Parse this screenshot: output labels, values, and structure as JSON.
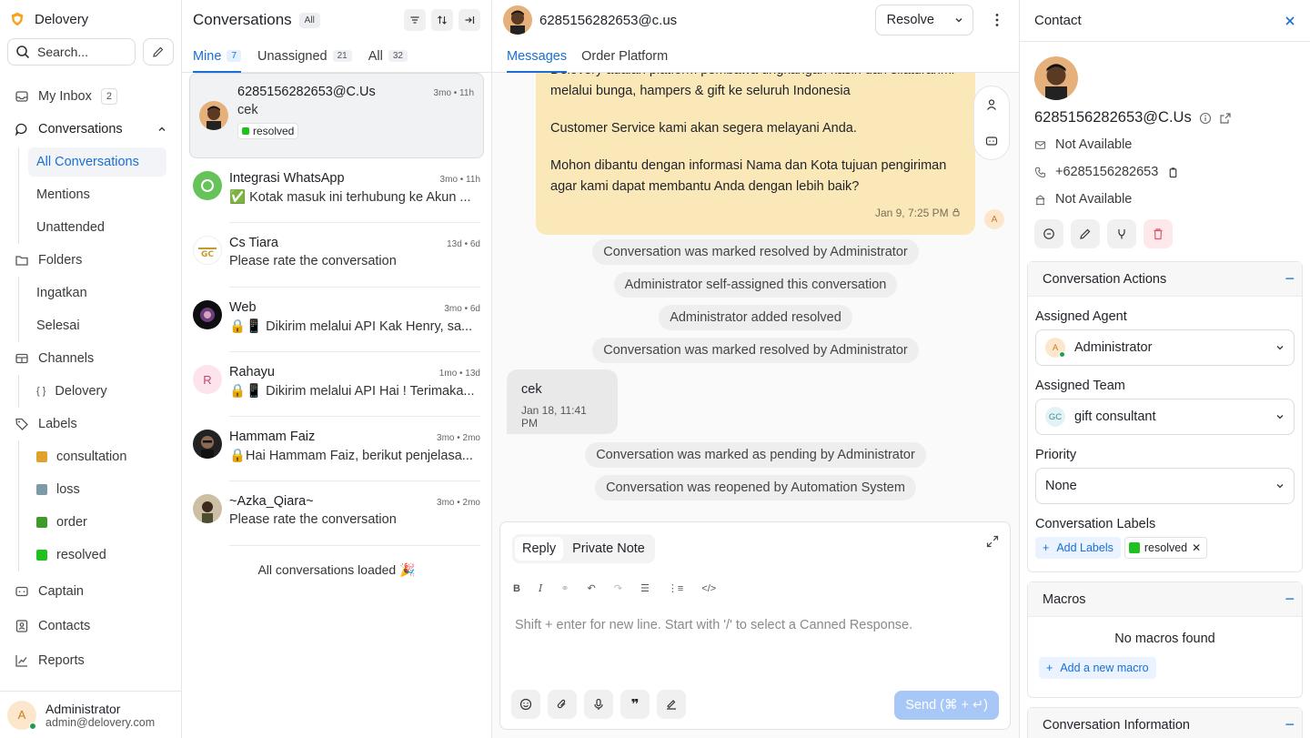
{
  "sidebar": {
    "brand": "Delovery",
    "search_placeholder": "Search...",
    "my_inbox": "My Inbox",
    "my_inbox_count": "2",
    "conversations": "Conversations",
    "conv_items": [
      "All Conversations",
      "Mentions",
      "Unattended"
    ],
    "folders": "Folders",
    "folder_items": [
      "Ingatkan",
      "Selesai"
    ],
    "channels": "Channels",
    "channel_items": [
      "Delovery"
    ],
    "labels": "Labels",
    "label_items": [
      {
        "name": "consultation",
        "color": "#e0a02c"
      },
      {
        "name": "loss",
        "color": "#7d9aa6"
      },
      {
        "name": "order",
        "color": "#3f9a2c"
      },
      {
        "name": "resolved",
        "color": "#20c020"
      }
    ],
    "captain": "Captain",
    "contacts": "Contacts",
    "reports": "Reports",
    "user": {
      "initial": "A",
      "name": "Administrator",
      "email": "admin@delovery.com"
    }
  },
  "conv_list": {
    "title": "Conversations",
    "filter_pill": "All",
    "tabs": [
      {
        "label": "Mine",
        "count": "7"
      },
      {
        "label": "Unassigned",
        "count": "21"
      },
      {
        "label": "All",
        "count": "32"
      }
    ],
    "items": [
      {
        "name": "6285156282653@C.Us",
        "time": "3mo • 11h",
        "msg": "cek",
        "label": "resolved"
      },
      {
        "name": "Integrasi WhatsApp",
        "time": "3mo • 11h",
        "msg": "✅ Kotak masuk ini terhubung ke Akun ..."
      },
      {
        "name": "Cs Tiara",
        "time": "13d • 6d",
        "msg": "Please rate the conversation"
      },
      {
        "name": "Web",
        "time": "3mo • 6d",
        "msg": "🔒📱 Dikirim melalui API Kak Henry, sa..."
      },
      {
        "name": "Rahayu",
        "initial": "R",
        "time": "1mo • 13d",
        "msg": "🔒📱 Dikirim melalui API Hai ! Terimaka..."
      },
      {
        "name": "Hammam Faiz",
        "time": "3mo • 2mo",
        "msg": "🔒Hai Hammam Faiz, berikut penjelasa..."
      },
      {
        "name": "~Azka_Qiara~",
        "time": "3mo • 2mo",
        "msg": "Please rate the conversation"
      }
    ],
    "all_loaded": "All conversations loaded 🎉"
  },
  "chat": {
    "contact": "6285156282653@c.us",
    "resolve_label": "Resolve",
    "tabs": [
      "Messages",
      "Order Platform"
    ],
    "out_lines": [
      "Delovery adalah platform pembawa ungkangan kasih dan silaturahmi melalui bunga, hampers & gift ke seluruh Indonesia",
      "Customer Service kami akan segera melayani Anda.",
      "Mohon dibantu dengan informasi Nama dan Kota tujuan pengiriman agar kami dapat membantu Anda dengan lebih baik?"
    ],
    "out_meta": "Jan 9, 7:25 PM",
    "agent_initial": "A",
    "activities_top": [
      "Conversation was marked resolved by Administrator",
      "Administrator self-assigned this conversation",
      "Administrator added resolved",
      "Conversation was marked resolved by Administrator"
    ],
    "in_text": "cek",
    "in_meta": "Jan 18, 11:41 PM",
    "activities_bottom": [
      "Conversation was marked as pending by Administrator",
      "Conversation was reopened by Automation System"
    ],
    "composer": {
      "reply": "Reply",
      "private_note": "Private Note",
      "placeholder": "Shift + enter for new line. Start with '/' to select a Canned Response.",
      "send": "Send (⌘ + ↵)"
    }
  },
  "contact": {
    "title": "Contact",
    "name": "6285156282653@C.Us",
    "email": "Not Available",
    "phone": "+6285156282653",
    "company": "Not Available",
    "actions_title": "Conversation Actions",
    "assigned_agent_label": "Assigned Agent",
    "assigned_agent": "Administrator",
    "assigned_agent_initial": "A",
    "assigned_team_label": "Assigned Team",
    "assigned_team": "gift consultant",
    "assigned_team_initials": "GC",
    "priority_label": "Priority",
    "priority": "None",
    "labels_title": "Conversation Labels",
    "add_labels": "Add Labels",
    "label": "resolved",
    "macros_title": "Macros",
    "no_macros": "No macros found",
    "add_macro": "Add a new macro",
    "info_title": "Conversation Information"
  },
  "colors": {
    "accent": "#1a6fd1",
    "outgoing_bubble": "#fbe8b9",
    "resolved": "#20c020"
  }
}
